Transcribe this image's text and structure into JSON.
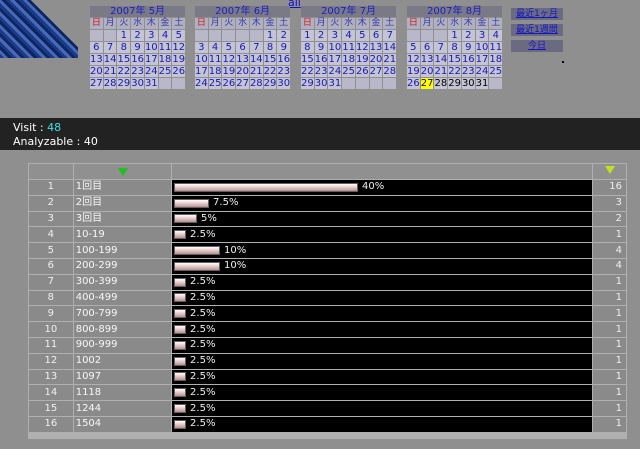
{
  "nav": {
    "all_label": "all"
  },
  "weekdays": [
    "日",
    "月",
    "火",
    "水",
    "木",
    "金",
    "土"
  ],
  "calendars": [
    {
      "title": "2007年 5月",
      "weeks": [
        [
          "",
          "",
          "1",
          "2",
          "3",
          "4",
          "5"
        ],
        [
          "6",
          "7",
          "8",
          "9",
          "10",
          "11",
          "12"
        ],
        [
          "13",
          "14",
          "15",
          "16",
          "17",
          "18",
          "19"
        ],
        [
          "20",
          "21",
          "22",
          "23",
          "24",
          "25",
          "26"
        ],
        [
          "27",
          "28",
          "29",
          "30",
          "31",
          "",
          ""
        ]
      ]
    },
    {
      "title": "2007年 6月",
      "weeks": [
        [
          "",
          "",
          "",
          "",
          "",
          "1",
          "2"
        ],
        [
          "3",
          "4",
          "5",
          "6",
          "7",
          "8",
          "9"
        ],
        [
          "10",
          "11",
          "12",
          "13",
          "14",
          "15",
          "16"
        ],
        [
          "17",
          "18",
          "19",
          "20",
          "21",
          "22",
          "23"
        ],
        [
          "24",
          "25",
          "26",
          "27",
          "28",
          "29",
          "30"
        ]
      ]
    },
    {
      "title": "2007年 7月",
      "weeks": [
        [
          "1",
          "2",
          "3",
          "4",
          "5",
          "6",
          "7"
        ],
        [
          "8",
          "9",
          "10",
          "11",
          "12",
          "13",
          "14"
        ],
        [
          "15",
          "16",
          "17",
          "18",
          "19",
          "20",
          "21"
        ],
        [
          "22",
          "23",
          "24",
          "25",
          "26",
          "27",
          "28"
        ],
        [
          "29",
          "30",
          "31",
          "",
          "",
          "",
          ""
        ]
      ]
    },
    {
      "title": "2007年 8月",
      "weeks": [
        [
          "",
          "",
          "",
          "1",
          "2",
          "3",
          "4"
        ],
        [
          "5",
          "6",
          "7",
          "8",
          "9",
          "10",
          "11"
        ],
        [
          "12",
          "13",
          "14",
          "15",
          "16",
          "17",
          "18"
        ],
        [
          "19",
          "20",
          "21",
          "22",
          "23",
          "24",
          "25"
        ],
        [
          "26",
          "27",
          "28",
          "29",
          "30",
          "31",
          ""
        ]
      ],
      "today": "27"
    }
  ],
  "quick_links": [
    "最近1ヶ月",
    "最近1週間",
    "今日"
  ],
  "stats": {
    "visit_label": "Visit : ",
    "visit_value": "48",
    "analyzable_label": "Analyzable : ",
    "analyzable_value": "40"
  },
  "table": {
    "icons": {
      "sort_desc": "triangle-down-icon",
      "sort_outline": "triangle-outline-icon"
    },
    "rows": [
      {
        "rank": "1",
        "label": "1回目",
        "pct": "40%",
        "share": 0.4,
        "count": "16"
      },
      {
        "rank": "2",
        "label": "2回目",
        "pct": "7.5%",
        "share": 0.075,
        "count": "3"
      },
      {
        "rank": "3",
        "label": "3回目",
        "pct": "5%",
        "share": 0.05,
        "count": "2"
      },
      {
        "rank": "4",
        "label": "10-19",
        "pct": "2.5%",
        "share": 0.025,
        "count": "1"
      },
      {
        "rank": "5",
        "label": "100-199",
        "pct": "10%",
        "share": 0.1,
        "count": "4"
      },
      {
        "rank": "6",
        "label": "200-299",
        "pct": "10%",
        "share": 0.1,
        "count": "4"
      },
      {
        "rank": "7",
        "label": "300-399",
        "pct": "2.5%",
        "share": 0.025,
        "count": "1"
      },
      {
        "rank": "8",
        "label": "400-499",
        "pct": "2.5%",
        "share": 0.025,
        "count": "1"
      },
      {
        "rank": "9",
        "label": "700-799",
        "pct": "2.5%",
        "share": 0.025,
        "count": "1"
      },
      {
        "rank": "10",
        "label": "800-899",
        "pct": "2.5%",
        "share": 0.025,
        "count": "1"
      },
      {
        "rank": "11",
        "label": "900-999",
        "pct": "2.5%",
        "share": 0.025,
        "count": "1"
      },
      {
        "rank": "12",
        "label": "1002",
        "pct": "2.5%",
        "share": 0.025,
        "count": "1"
      },
      {
        "rank": "13",
        "label": "1097",
        "pct": "2.5%",
        "share": 0.025,
        "count": "1"
      },
      {
        "rank": "14",
        "label": "1118",
        "pct": "2.5%",
        "share": 0.025,
        "count": "1"
      },
      {
        "rank": "15",
        "label": "1244",
        "pct": "2.5%",
        "share": 0.025,
        "count": "1"
      },
      {
        "rank": "16",
        "label": "1504",
        "pct": "2.5%",
        "share": 0.025,
        "count": "1"
      }
    ]
  }
}
